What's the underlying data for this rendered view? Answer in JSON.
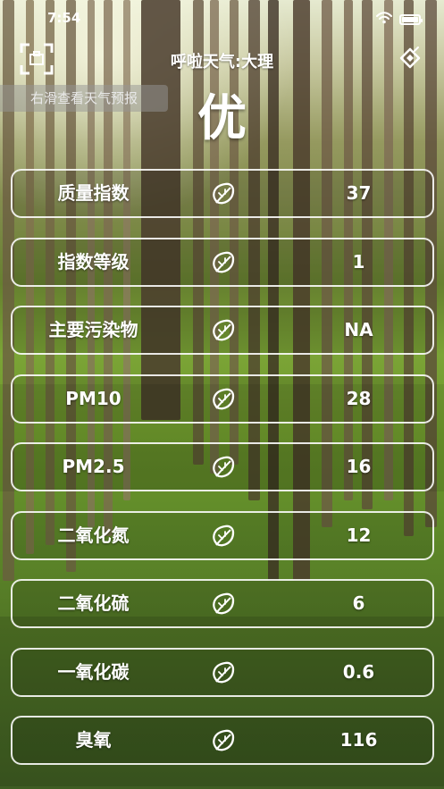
{
  "status_bar": {
    "time": "7:54"
  },
  "header": {
    "title": "呼啦天气:大理"
  },
  "hint": {
    "text": "右滑查看天气预报"
  },
  "aqi": {
    "grade": "优"
  },
  "rows": [
    {
      "label": "质量指数",
      "value": "37"
    },
    {
      "label": "指数等级",
      "value": "1"
    },
    {
      "label": "主要污染物",
      "value": "NA"
    },
    {
      "label": "PM10",
      "value": "28"
    },
    {
      "label": "PM2.5",
      "value": "16"
    },
    {
      "label": "二氧化氮",
      "value": "12"
    },
    {
      "label": "二氧化硫",
      "value": "6"
    },
    {
      "label": "一氧化碳",
      "value": "0.6"
    },
    {
      "label": "臭氧",
      "value": "116"
    }
  ],
  "icons": {
    "scan": "scan-icon",
    "share": "share-icon",
    "row": "leaf-icon",
    "wifi": "wifi-icon",
    "battery": "battery-icon"
  },
  "colors": {
    "text": "#ffffff",
    "row_border": "#ffffff",
    "hint_bg": "#969696"
  }
}
